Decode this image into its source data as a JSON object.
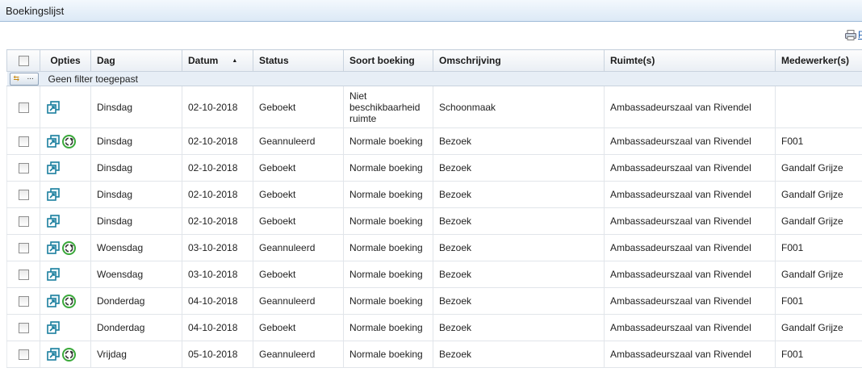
{
  "window": {
    "title": "Boekingslijst"
  },
  "toolbar": {
    "print_label": "P"
  },
  "columns": {
    "opties": "Opties",
    "dag": "Dag",
    "datum": "Datum",
    "status": "Status",
    "soort": "Soort boeking",
    "omschrijving": "Omschrijving",
    "ruimte": "Ruimte(s)",
    "medewerker": "Medewerker(s)"
  },
  "sort": {
    "column": "Datum",
    "direction": "ascending",
    "icon": "sort-ascending-icon"
  },
  "filter": {
    "button_dots": "...",
    "text": "Geen filter toegepast"
  },
  "rows": [
    {
      "dag": "Dinsdag",
      "datum": "02-10-2018",
      "status": "Geboekt",
      "soort": "Niet beschikbaarheid ruimte",
      "omschrijving": "Schoonmaak",
      "ruimte": "Ambassadeurszaal van Rivendel",
      "medewerker": "",
      "cycle_icon": false
    },
    {
      "dag": "Dinsdag",
      "datum": "02-10-2018",
      "status": "Geannuleerd",
      "soort": "Normale boeking",
      "omschrijving": "Bezoek",
      "ruimte": "Ambassadeurszaal van Rivendel",
      "medewerker": "F001",
      "cycle_icon": true
    },
    {
      "dag": "Dinsdag",
      "datum": "02-10-2018",
      "status": "Geboekt",
      "soort": "Normale boeking",
      "omschrijving": "Bezoek",
      "ruimte": "Ambassadeurszaal van Rivendel",
      "medewerker": "Gandalf Grijze",
      "cycle_icon": false
    },
    {
      "dag": "Dinsdag",
      "datum": "02-10-2018",
      "status": "Geboekt",
      "soort": "Normale boeking",
      "omschrijving": "Bezoek",
      "ruimte": "Ambassadeurszaal van Rivendel",
      "medewerker": "Gandalf Grijze",
      "cycle_icon": false
    },
    {
      "dag": "Dinsdag",
      "datum": "02-10-2018",
      "status": "Geboekt",
      "soort": "Normale boeking",
      "omschrijving": "Bezoek",
      "ruimte": "Ambassadeurszaal van Rivendel",
      "medewerker": "Gandalf Grijze",
      "cycle_icon": false
    },
    {
      "dag": "Woensdag",
      "datum": "03-10-2018",
      "status": "Geannuleerd",
      "soort": "Normale boeking",
      "omschrijving": "Bezoek",
      "ruimte": "Ambassadeurszaal van Rivendel",
      "medewerker": "F001",
      "cycle_icon": true
    },
    {
      "dag": "Woensdag",
      "datum": "03-10-2018",
      "status": "Geboekt",
      "soort": "Normale boeking",
      "omschrijving": "Bezoek",
      "ruimte": "Ambassadeurszaal van Rivendel",
      "medewerker": "Gandalf Grijze",
      "cycle_icon": false
    },
    {
      "dag": "Donderdag",
      "datum": "04-10-2018",
      "status": "Geannuleerd",
      "soort": "Normale boeking",
      "omschrijving": "Bezoek",
      "ruimte": "Ambassadeurszaal van Rivendel",
      "medewerker": "F001",
      "cycle_icon": true
    },
    {
      "dag": "Donderdag",
      "datum": "04-10-2018",
      "status": "Geboekt",
      "soort": "Normale boeking",
      "omschrijving": "Bezoek",
      "ruimte": "Ambassadeurszaal van Rivendel",
      "medewerker": "Gandalf Grijze",
      "cycle_icon": false
    },
    {
      "dag": "Vrijdag",
      "datum": "05-10-2018",
      "status": "Geannuleerd",
      "soort": "Normale boeking",
      "omschrijving": "Bezoek",
      "ruimte": "Ambassadeurszaal van Rivendel",
      "medewerker": "F001",
      "cycle_icon": true
    }
  ],
  "icons": {
    "open": "open-window-icon",
    "cycle": "recurring-cycle-icon",
    "print": "printer-icon"
  },
  "colors": {
    "header_bg": "#dce9f6",
    "filter_bg": "#e7eef6",
    "link": "#1f5fb0",
    "icon_teal": "#1a7f9e",
    "icon_green": "#3aa83a"
  }
}
